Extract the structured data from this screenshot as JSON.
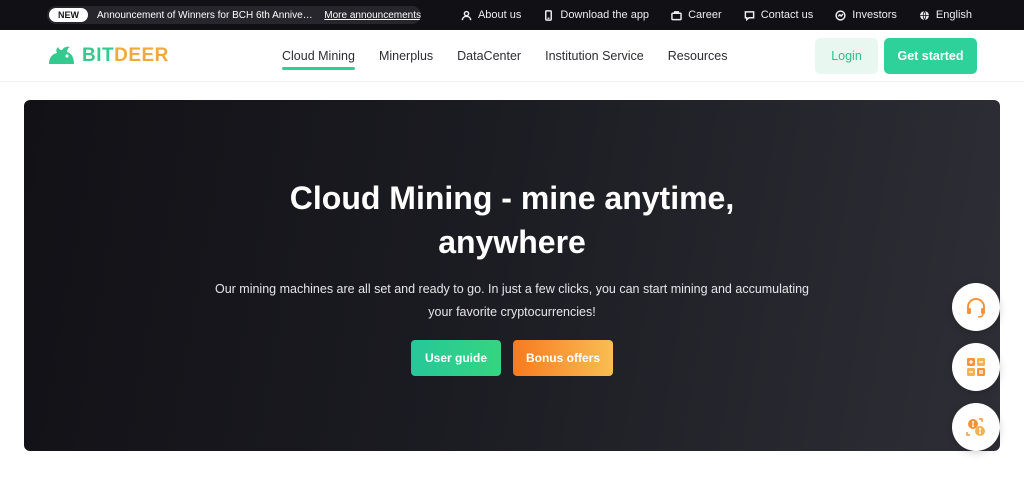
{
  "topbar": {
    "badge": "NEW",
    "announcement": "Announcement of Winners for BCH 6th Anniversary Bl...",
    "more": "More announcements",
    "links": [
      {
        "label": "About us",
        "icon": "user-icon"
      },
      {
        "label": "Download the app",
        "icon": "phone-icon"
      },
      {
        "label": "Career",
        "icon": "briefcase-icon"
      },
      {
        "label": "Contact us",
        "icon": "chat-icon"
      },
      {
        "label": "Investors",
        "icon": "investor-icon"
      },
      {
        "label": "English",
        "icon": "globe-icon"
      }
    ]
  },
  "nav": {
    "logo_part1": "BIT",
    "logo_part2": "DEER",
    "items": [
      {
        "label": "Cloud Mining",
        "active": true
      },
      {
        "label": "Minerplus",
        "active": false
      },
      {
        "label": "DataCenter",
        "active": false
      },
      {
        "label": "Institution Service",
        "active": false
      },
      {
        "label": "Resources",
        "active": false
      }
    ],
    "login": "Login",
    "get_started": "Get started"
  },
  "hero": {
    "title": "Cloud Mining - mine anytime, anywhere",
    "subtitle": "Our mining machines are all set and ready to go. In just a few clicks, you can start mining and accumulating your favorite cryptocurrencies!",
    "user_guide": "User guide",
    "bonus_offers": "Bonus offers"
  },
  "floating": [
    {
      "icon": "headset-icon"
    },
    {
      "icon": "calculator-icon"
    },
    {
      "icon": "exchange-icon"
    }
  ],
  "colors": {
    "brand_green": "#2fd19a",
    "brand_orange": "#f2a93b",
    "topbar_bg": "#101015"
  }
}
